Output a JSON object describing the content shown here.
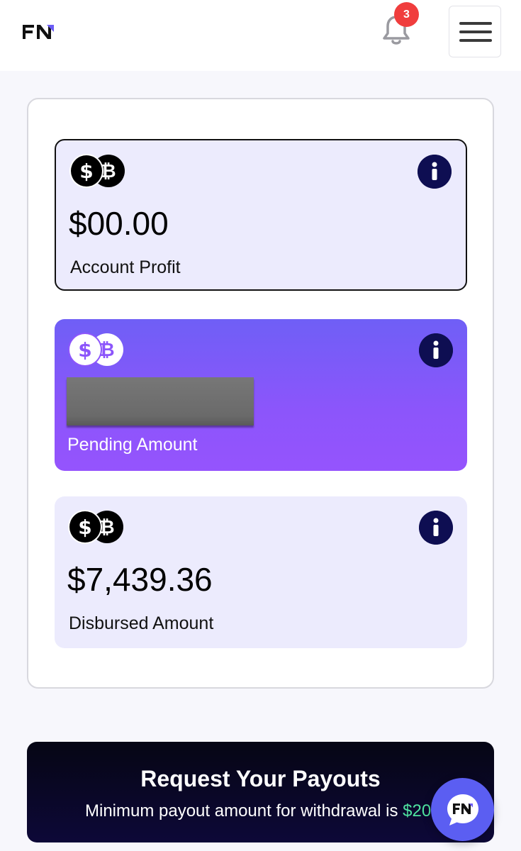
{
  "header": {
    "logo_text": "FN",
    "notification_count": "3"
  },
  "cards": {
    "profit": {
      "amount": "$00.00",
      "label": "Account Profit"
    },
    "pending": {
      "amount": "",
      "label": "Pending Amount"
    },
    "disbursed": {
      "amount": "$7,439.36",
      "label": "Disbursed Amount"
    }
  },
  "payout": {
    "title": "Request Your Payouts",
    "subtitle_prefix": "Minimum payout amount for withdrawal is ",
    "subtitle_amount": "$20"
  },
  "chat": {
    "logo_text": "FN"
  },
  "colors": {
    "accent_purple": "#8c55fb",
    "info_navy": "#0e0e52",
    "badge_red": "#f03d3d",
    "min_green": "#4fe3a0"
  },
  "icons": {
    "logo": "fn-logo-icon",
    "bell": "bell-icon",
    "menu": "hamburger-menu-icon",
    "coins": "dollar-bitcoin-coins-icon",
    "info": "info-icon",
    "chat": "chat-bubble-icon"
  }
}
